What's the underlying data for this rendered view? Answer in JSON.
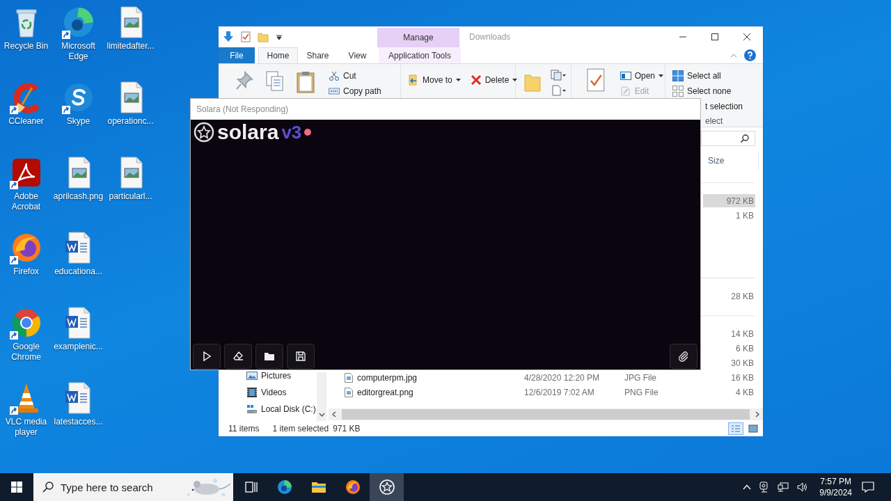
{
  "desktop_icons": [
    {
      "label": "Recycle Bin",
      "kind": "recycle",
      "shortcut": false
    },
    {
      "label": "CCleaner",
      "kind": "ccleaner",
      "shortcut": true
    },
    {
      "label": "Adobe Acrobat",
      "kind": "acrobat",
      "shortcut": true
    },
    {
      "label": "Firefox",
      "kind": "firefox",
      "shortcut": true
    },
    {
      "label": "Google Chrome",
      "kind": "chrome",
      "shortcut": true
    },
    {
      "label": "VLC media player",
      "kind": "vlc",
      "shortcut": true
    },
    {
      "label": "Microsoft Edge",
      "kind": "edge",
      "shortcut": true
    },
    {
      "label": "Skype",
      "kind": "skype",
      "shortcut": true
    },
    {
      "label": "aprilcash.png",
      "kind": "image",
      "shortcut": false
    },
    {
      "label": "educationa...",
      "kind": "word",
      "shortcut": false
    },
    {
      "label": "examplenic...",
      "kind": "word",
      "shortcut": false
    },
    {
      "label": "latestacces...",
      "kind": "word",
      "shortcut": false
    },
    {
      "label": "limitedafter...",
      "kind": "image",
      "shortcut": false
    },
    {
      "label": "operationc...",
      "kind": "image",
      "shortcut": false
    },
    {
      "label": "particularl...",
      "kind": "image",
      "shortcut": false
    }
  ],
  "explorer": {
    "title": "Downloads",
    "context_tab": "Manage",
    "tabs": [
      {
        "label": "File",
        "kind": "file",
        "selected": false
      },
      {
        "label": "Home",
        "kind": "plain",
        "selected": true
      },
      {
        "label": "Share",
        "kind": "plain",
        "selected": false
      },
      {
        "label": "View",
        "kind": "plain",
        "selected": false
      },
      {
        "label": "Application Tools",
        "kind": "contextual",
        "selected": false
      }
    ],
    "ribbon": {
      "clipboard": [
        {
          "label": "Cut",
          "kind": "cut"
        },
        {
          "label": "Copy path",
          "kind": "copy-path"
        }
      ],
      "organize": [
        {
          "label": "Move to",
          "kind": "move",
          "dropdown": true
        },
        {
          "label": "Delete",
          "kind": "delete",
          "dropdown": true
        }
      ],
      "open": [
        {
          "label": "Open",
          "kind": "open",
          "dropdown": true,
          "disabled": false
        },
        {
          "label": "Edit",
          "kind": "edit",
          "dropdown": false,
          "disabled": true
        }
      ],
      "select": [
        {
          "label": "Select all",
          "kind": "select-all"
        },
        {
          "label": "Select none",
          "kind": "select-none"
        },
        {
          "label": "t selection",
          "kind": "invert"
        }
      ],
      "select_group_label": "elect"
    },
    "column": "Size",
    "groups": [
      {
        "rows": [
          {
            "size": "972 KB",
            "selected": true
          },
          {
            "size": "1 KB",
            "selected": false
          }
        ]
      },
      {
        "rows": [
          {
            "size": "28 KB",
            "selected": false
          }
        ]
      },
      {
        "rows": [
          {
            "size": "14 KB",
            "selected": false
          },
          {
            "size": "6 KB",
            "selected": false
          },
          {
            "size": "30 KB",
            "selected": false
          },
          {
            "name": "computerpm.jpg",
            "date": "4/28/2020 12:20 PM",
            "type": "JPG File",
            "size": "16 KB",
            "selected": false
          },
          {
            "name": "editorgreat.png",
            "date": "12/6/2019 7:02 AM",
            "type": "PNG File",
            "size": "4 KB",
            "selected": false
          }
        ]
      }
    ],
    "nav": [
      {
        "label": "Pictures",
        "kind": "pictures"
      },
      {
        "label": "Videos",
        "kind": "videos"
      },
      {
        "label": "Local Disk (C:)",
        "kind": "disk"
      }
    ],
    "status": {
      "count": "11 items",
      "selection": "1 item selected",
      "size": "971 KB"
    },
    "views": [
      {
        "kind": "details",
        "selected": true
      },
      {
        "kind": "large",
        "selected": false
      }
    ]
  },
  "solara": {
    "title": "Solara (Not Responding)",
    "logo": "solara",
    "version": "v3",
    "tools": [
      {
        "kind": "run"
      },
      {
        "kind": "clear"
      },
      {
        "kind": "open"
      },
      {
        "kind": "save"
      }
    ],
    "side_tools": [
      {
        "kind": "attach"
      }
    ]
  },
  "taskbar": {
    "search_placeholder": "Type here to search",
    "apps": [
      {
        "kind": "task-view",
        "selected": false
      },
      {
        "kind": "edge",
        "selected": false
      },
      {
        "kind": "explorer",
        "selected": false
      },
      {
        "kind": "firefox",
        "selected": false
      },
      {
        "kind": "solara",
        "selected": true
      }
    ],
    "time": "7:57 PM",
    "date": "9/9/2024"
  }
}
